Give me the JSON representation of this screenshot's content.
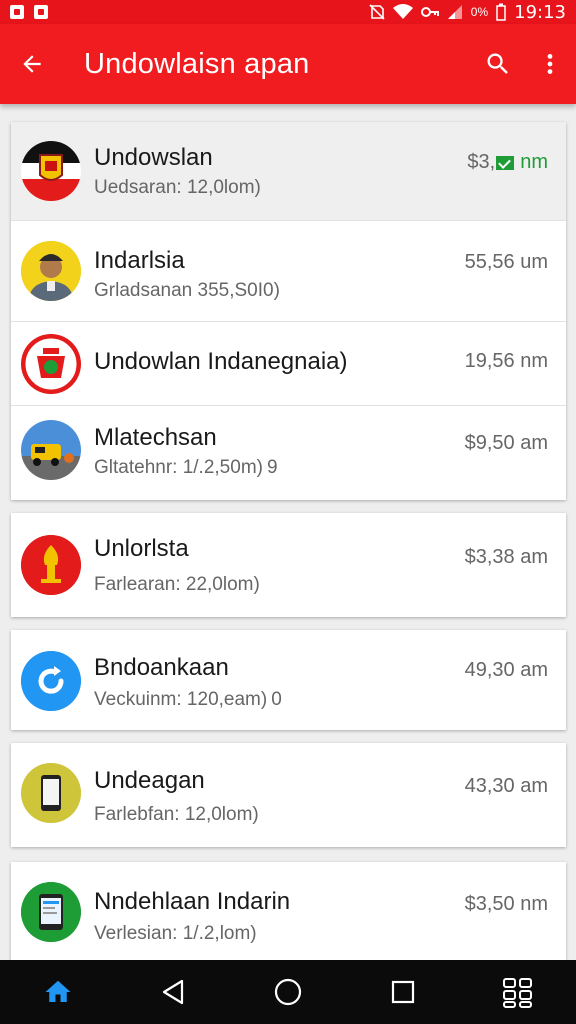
{
  "status_bar": {
    "battery": "0%",
    "time": "19:13"
  },
  "app_bar": {
    "title": "Undowlaisn apan"
  },
  "items": [
    {
      "title": "Undowslan",
      "subtitle": "Uedsaran: 12,0lom)",
      "trailing": "$3,",
      "trailing_green": "nm"
    },
    {
      "title": "Indarlsia",
      "subtitle": "Grladsanan 355,S0I0)",
      "trailing": "55,56 um"
    },
    {
      "title": "Undowlan Indanegnaia)",
      "subtitle": "",
      "trailing": "19,56 nm"
    },
    {
      "title": "Mlatechsan",
      "subtitle": "Gltatehnr: 1/.2,50m)",
      "subtitle_extra": "9",
      "trailing": "$9,50 am"
    },
    {
      "title": "Unlorlsta",
      "subtitle": "Farlearan: 22,0lom)",
      "trailing": "$3,38 am"
    },
    {
      "title": "Bndoankaan",
      "subtitle": "Veckuinm: 120,eam)",
      "subtitle_extra": "0",
      "trailing": "49,30 am"
    },
    {
      "title": "Undeagan",
      "subtitle": "Farlebfan: 12,0lom)",
      "trailing": "43,30 am"
    },
    {
      "title": "Nndehlaan Indarin",
      "subtitle": "Verlesian: 1/.2,lom)",
      "trailing": "$3,50 nm"
    }
  ],
  "colors": {
    "primary": "#f01c1f",
    "status_bar": "#e8141b",
    "accent_green": "#1e9c36",
    "nav_home": "#2196f3"
  }
}
